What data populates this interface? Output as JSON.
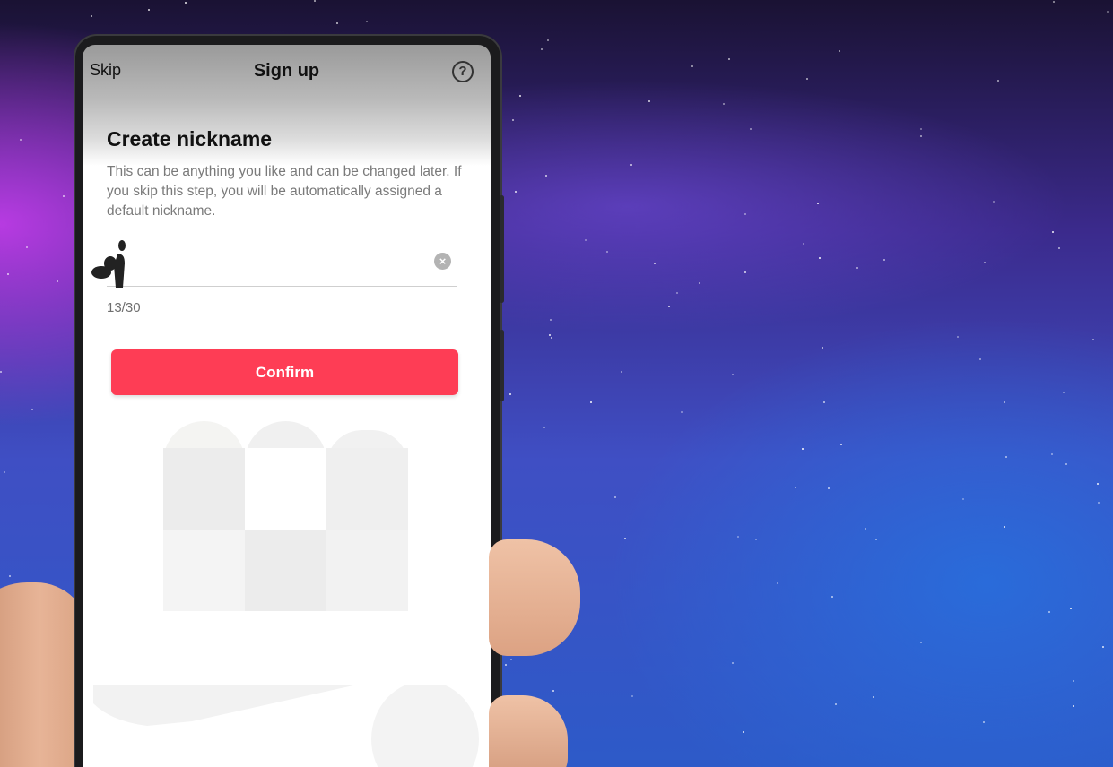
{
  "window": {
    "size": "1241x856"
  },
  "app": {
    "title": "Sign up",
    "skip_label": "Skip",
    "help_icon": "help-circle-icon"
  },
  "screen": {
    "heading": "Create nickname",
    "description": "This can be anything you like and can be changed later. If you skip this step, you will be automatically assigned a default nickname.",
    "nickname_input": {
      "value": "",
      "clear_icon": "clear-circle-icon"
    },
    "character_counter": "13/30",
    "confirm_label": "Confirm"
  },
  "colors": {
    "accent": "#fe3d55",
    "background_top": "#1a1233",
    "background_purple": "#be3ce6",
    "background_blue": "#2d5ac8"
  }
}
